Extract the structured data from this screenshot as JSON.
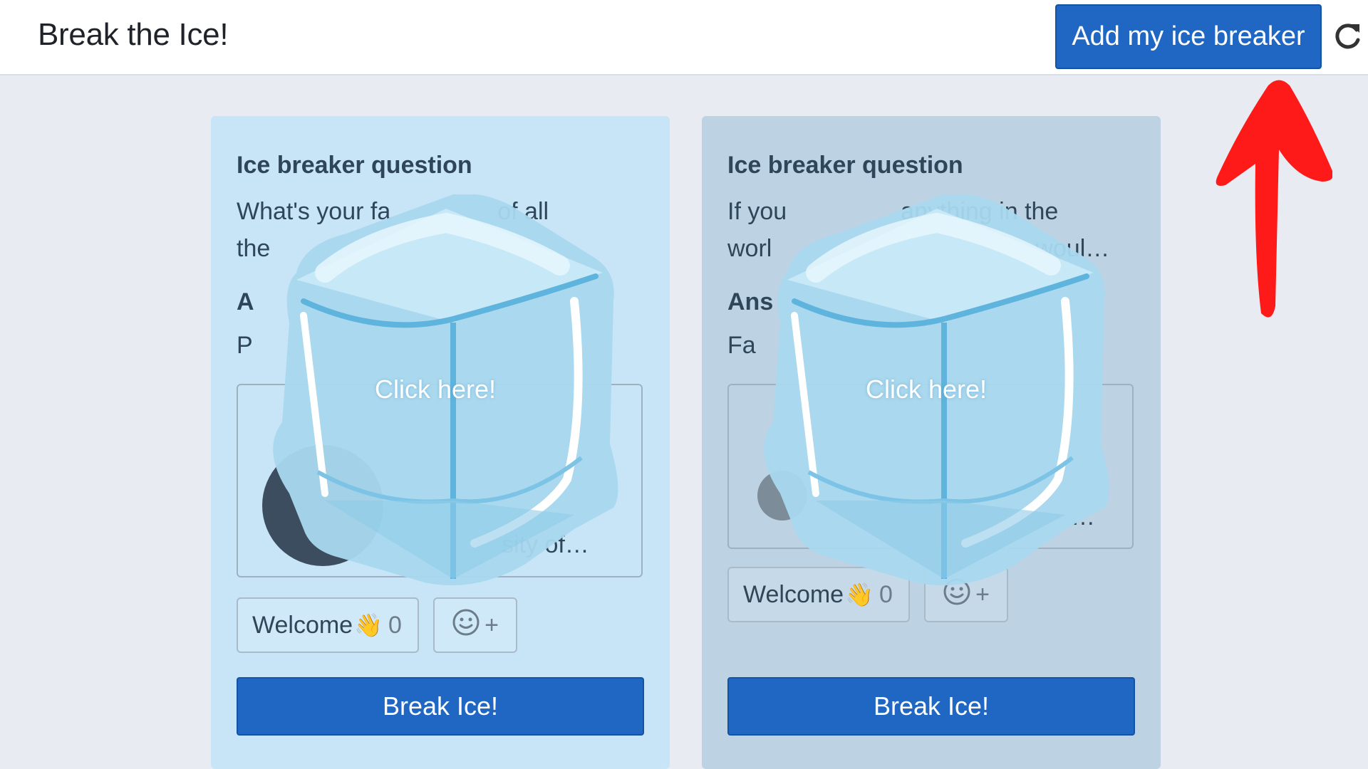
{
  "header": {
    "title": "Break the Ice!",
    "add_button_label": "Add my ice breaker"
  },
  "cards": [
    {
      "question_heading": "Ice breaker question",
      "question_text": "What's your fa",
      "question_text_end": "of all",
      "question_line2": "the",
      "answer_heading": "A",
      "answer_text": "P",
      "profile_snippet": "sity of…",
      "reaction_label": "Welcome",
      "reaction_emoji": "👋",
      "reaction_count": "0",
      "add_reaction_plus": "+",
      "ice_label": "Click here!",
      "break_button_label": "Break Ice!"
    },
    {
      "question_heading": "Ice breaker question",
      "question_text": "If you",
      "question_text_end": "anything in the",
      "question_line2": "worl",
      "question_line2_end": "woul…",
      "answer_heading": "Ans",
      "answer_text": "Fa",
      "profile_snippet": "…",
      "reaction_label": "Welcome",
      "reaction_emoji": "👋",
      "reaction_count": "0",
      "add_reaction_plus": "+",
      "ice_label": "Click here!",
      "break_button_label": "Break Ice!"
    }
  ],
  "colors": {
    "primary": "#1f67c2",
    "card1_bg": "#c8e5f8",
    "card2_bg": "#bdd3e4",
    "annotation_arrow": "#ff1a1a"
  },
  "icons": {
    "refresh": "refresh-icon",
    "smiley": "smiley-icon",
    "ice": "ice-cube-icon",
    "arrow": "red-arrow-annotation"
  }
}
